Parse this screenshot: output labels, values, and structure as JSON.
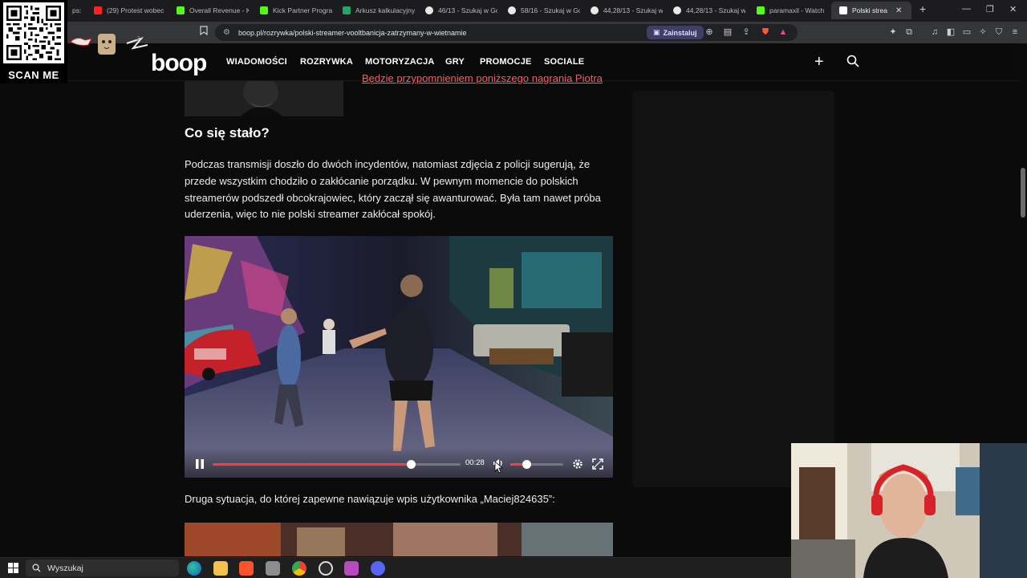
{
  "browser": {
    "tabs": [
      {
        "label": "ps:",
        "fav_color": "#3a82f7"
      },
      {
        "label": "(29) Protest wobec",
        "fav_color": "#ff2020"
      },
      {
        "label": "Overall Revenue - K",
        "fav_color": "#53fc18"
      },
      {
        "label": "Kick Partner Progra",
        "fav_color": "#53fc18"
      },
      {
        "label": "Arkusz kalkulacyjny",
        "fav_color": "#23a566"
      },
      {
        "label": "46/13 - Szukaj w Go",
        "fav_color": "#e8e8e8"
      },
      {
        "label": "58/16 - Szukaj w Go",
        "fav_color": "#e8e8e8"
      },
      {
        "label": "44,28/13 - Szukaj w",
        "fav_color": "#e8e8e8"
      },
      {
        "label": "44,28/13 - Szukaj w",
        "fav_color": "#e8e8e8"
      },
      {
        "label": "paramaxil - Watch",
        "fav_color": "#53fc18"
      },
      {
        "label": "Polski strea",
        "fav_color": "#ffffff",
        "active": true
      }
    ],
    "new_tab": "+",
    "window_controls": [
      "—",
      "❐",
      "✕"
    ],
    "url": "boop.pl/rozrywka/polski-streamer-vooltbanicja-zatrzymany-w-wietnamie",
    "install_label": "Zainstaluj"
  },
  "overlay": {
    "qr_caption": "SCAN ME"
  },
  "site": {
    "logo": "boop",
    "nav": [
      "WIADOMOŚCI",
      "ROZRYWKA",
      "MOTORYZACJA",
      "GRY",
      "PROMOCJE",
      "SOCIALE"
    ]
  },
  "article": {
    "related_link": "Będzie przypomnieniem poniższego nagrania Piotra.",
    "heading": "Co się stało?",
    "paragraph1": "Podczas transmisji doszło do dwóch incydentów, natomiast zdjęcia z policji sugerują, że przede wszystkim chodziło o zakłócanie porządku. W pewnym momencie do polskich streamerów podszedł obcokrajowiec, który zaczął się awanturować. Była tam nawet próba uderzenia, więc to nie polski streamer zakłócał spokój.",
    "paragraph2": "Druga sytuacja, do której zapewne nawiązuje wpis użytkownika „Maciej824635”:"
  },
  "video": {
    "time": "00:28",
    "progress": 0.8,
    "volume": 0.3,
    "colors": {
      "progress": "#ff3b3b"
    }
  },
  "taskbar": {
    "search_placeholder": "Wyszukaj"
  }
}
